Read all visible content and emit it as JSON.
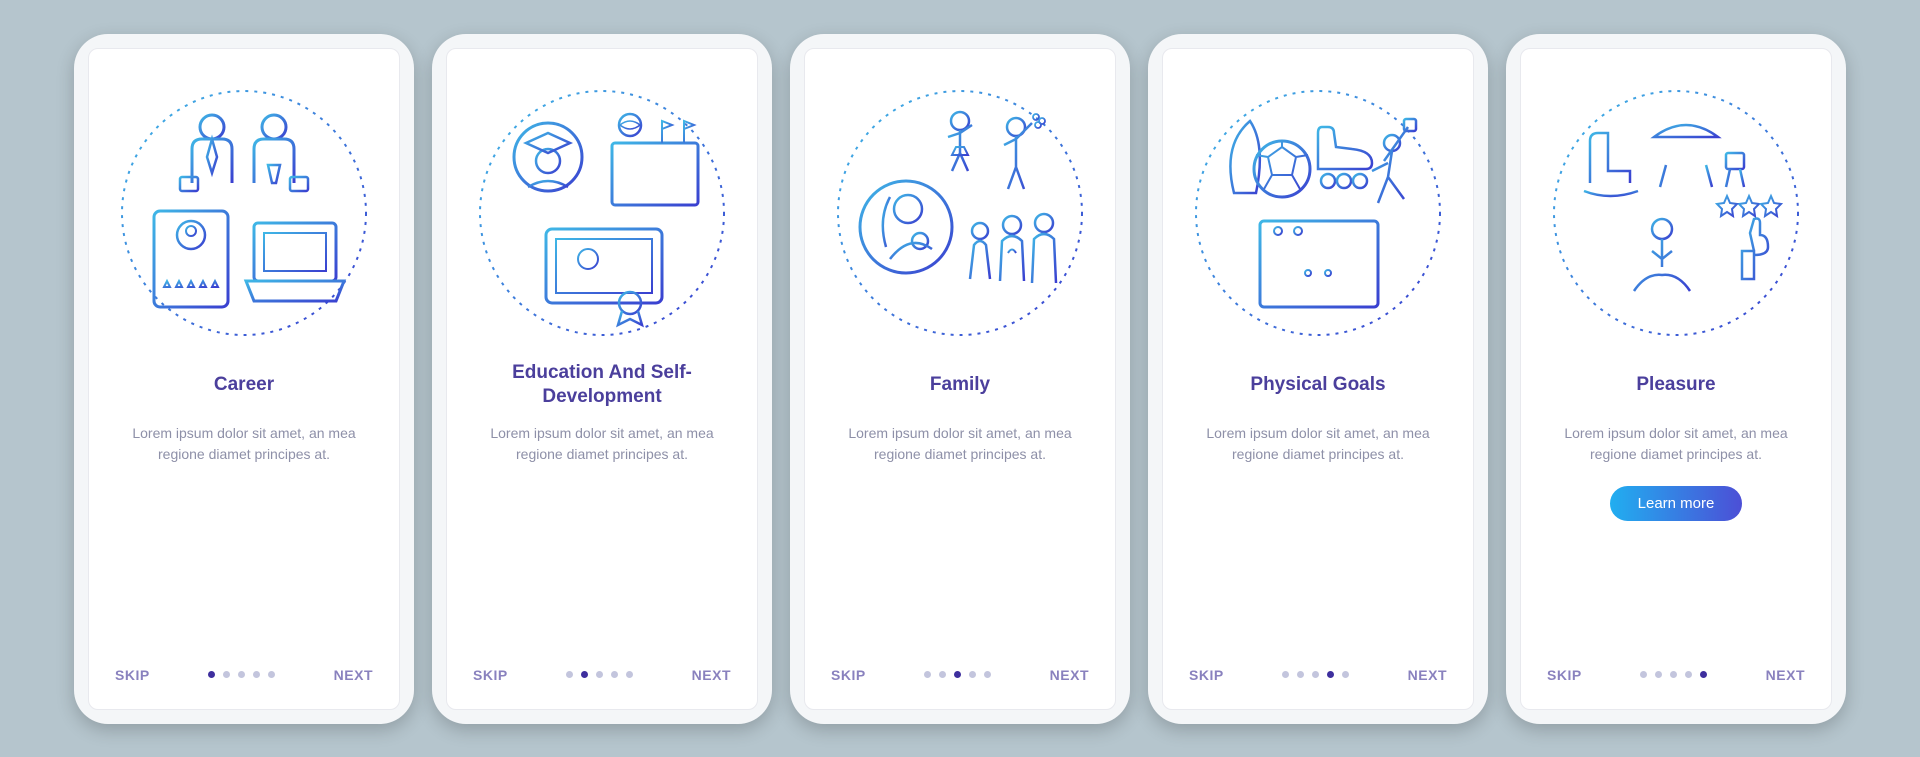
{
  "screens": [
    {
      "title": "Career",
      "desc": "Lorem ipsum dolor sit amet, an mea regione diamet principes at.",
      "icon": "career-icon",
      "activeDot": 0,
      "skip": "SKIP",
      "next": "NEXT",
      "cta": null
    },
    {
      "title": "Education And Self-Development",
      "desc": "Lorem ipsum dolor sit amet, an mea regione diamet principes at.",
      "icon": "education-icon",
      "activeDot": 1,
      "skip": "SKIP",
      "next": "NEXT",
      "cta": null
    },
    {
      "title": "Family",
      "desc": "Lorem ipsum dolor sit amet, an mea regione diamet principes at.",
      "icon": "family-icon",
      "activeDot": 2,
      "skip": "SKIP",
      "next": "NEXT",
      "cta": null
    },
    {
      "title": "Physical Goals",
      "desc": "Lorem ipsum dolor sit amet, an mea regione diamet principes at.",
      "icon": "physical-goals-icon",
      "activeDot": 3,
      "skip": "SKIP",
      "next": "NEXT",
      "cta": null
    },
    {
      "title": "Pleasure",
      "desc": "Lorem ipsum dolor sit amet, an mea regione diamet principes at.",
      "icon": "pleasure-icon",
      "activeDot": 4,
      "skip": "SKIP",
      "next": "NEXT",
      "cta": "Learn more"
    }
  ],
  "dotCount": 5,
  "colors": {
    "accent": "#4b3f9c",
    "strokeLight": "#3fb7e6",
    "strokeDark": "#3a3fd0"
  }
}
